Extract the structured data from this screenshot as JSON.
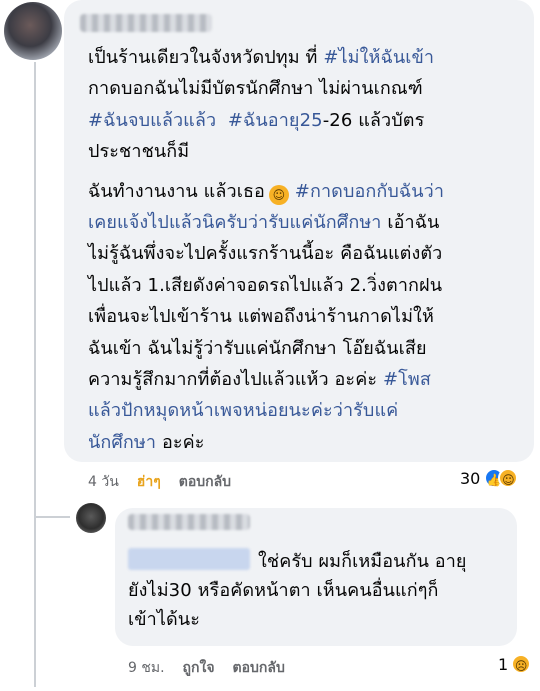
{
  "comment": {
    "lines": [
      "เป็นร้านเดียวในจังหวัดปทุม ที่",
      "#ไม่ให้ฉันเข้า",
      "กาดบอกฉันไม่มีบัตรนักศึกษา ไม่ผ่านเกณฑ์",
      "#ฉันจบแล้วแล้ว",
      "#ฉันอายุ25",
      "-26 แล้วบัตร",
      "ประชาชนก็มี",
      "ฉันทำงานงาน แล้วเธอ",
      "#กาดบอกกับฉันว่า",
      "เคยแจ้งไปแล้วนิครับว่ารับแค่นักศึกษา",
      "เอ้าฉัน",
      "ไม่รู้ฉันพึ่งจะไปครั้งแรกร้านนี้อะ คือฉันแต่งตัว",
      "ไปแล้ว 1.เสียดังค่าจอดรถไปแล้ว 2.วิ่งตากฝน",
      "เพื่อนจะไปเข้าร้าน แต่พอถึงน่าร้านกาดไม่ให้",
      "ฉันเข้า ฉันไม่รู้ว่ารับแค่นักศึกษา โอ๊ยฉันเสีย",
      "ความรู้สึกมากที่ต้องไปแล้วแห้ว อะค่ะ",
      "#โพส",
      "แล้วปักหมุดหน้าเพจหน่อยนะค่ะว่ารับแค่",
      "นักศึกษา",
      "อะค่ะ"
    ],
    "time": "4 วัน",
    "like_label": "ฮ่าๆ",
    "reply_label": "ตอบกลับ",
    "reaction_count": "30",
    "reaction_icons": [
      "like-icon",
      "haha-icon"
    ],
    "inline_emoji": "laughing-emoji"
  },
  "reply": {
    "lines": [
      "ใช่ครับ ผมก็เหมือนกัน อายุ",
      "ยังไม่30 หรือคัดหน้าตา เห็นคนอื่นแก่ๆก็",
      "เข้าได้นะ"
    ],
    "time": "9 ชม.",
    "like_label": "ถูกใจ",
    "reply_label": "ตอบกลับ",
    "reaction_count": "1",
    "reaction_icons": [
      "sad-icon"
    ]
  },
  "colors": {
    "bubble": "#f0f2f5",
    "hashtag": "#385898",
    "meta": "#65676b",
    "liked": "#e8a31c",
    "like_blue": "#1877f2"
  }
}
